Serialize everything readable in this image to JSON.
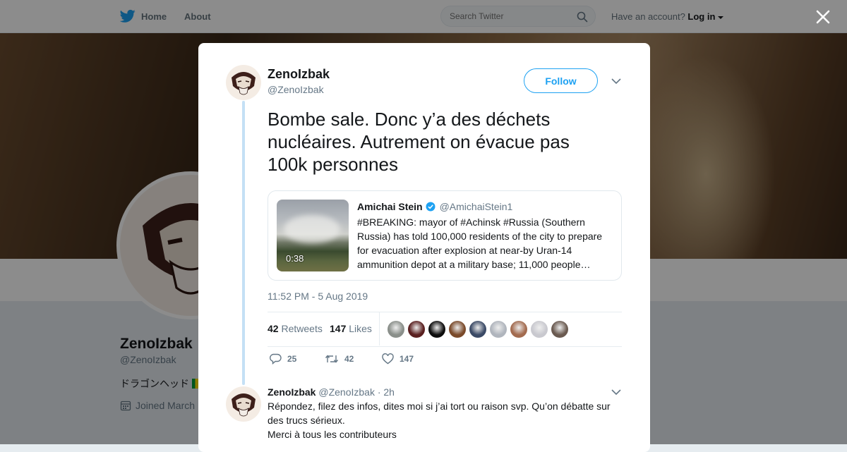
{
  "nav": {
    "home_label": "Home",
    "about_label": "About",
    "search_placeholder": "Search Twitter",
    "account_prompt": "Have an account?",
    "login_label": "Log in"
  },
  "profile": {
    "name": "ZenoIzbak",
    "handle": "@ZenoIzbak",
    "bio": "ドラゴンヘッド",
    "joined": "Joined March"
  },
  "tweet": {
    "author_name": "ZenoIzbak",
    "author_handle": "@ZenoIzbak",
    "follow_label": "Follow",
    "text": "Bombe sale. Donc y’a des déchets nucléaires. Autrement on évacue pas 100k personnes",
    "timestamp": "11:52 PM - 5 Aug 2019",
    "retweets_count": "42",
    "retweets_label": "Retweets",
    "likes_count": "147",
    "likes_label": "Likes",
    "reply_count": "25",
    "retweet_action_count": "42",
    "like_action_count": "147",
    "likers": [
      "#8a8f8a",
      "#5a2020",
      "#0d0d0d",
      "#7a4a2a",
      "#3b4a66",
      "#b0b5bd",
      "#a36b4f",
      "#c9c9cf",
      "#6a5a50"
    ]
  },
  "quote": {
    "author_name": "Amichai Stein",
    "author_handle": "@AmichaiStein1",
    "verified": true,
    "media_duration": "0:38",
    "text": "#BREAKING: mayor of #Achinsk #Russia (Southern Russia) has told 100,000 residents of the city to prepare for evacuation after explosion at near-by Uran-14 ammunition depot at a military base; 11,000 people…"
  },
  "reply": {
    "author_name": "ZenoIzbak",
    "author_handle": "@ZenoIzbak",
    "time": "· 2h",
    "line1": "Répondez, filez des infos, dites moi si j’ai tort ou raison svp. Qu’on débatte sur des trucs sérieux.",
    "line2": "Merci à tous les contributeurs"
  },
  "colors": {
    "accent": "#1da1f2",
    "thread_line": "#c4e0f5",
    "muted": "#657786"
  }
}
